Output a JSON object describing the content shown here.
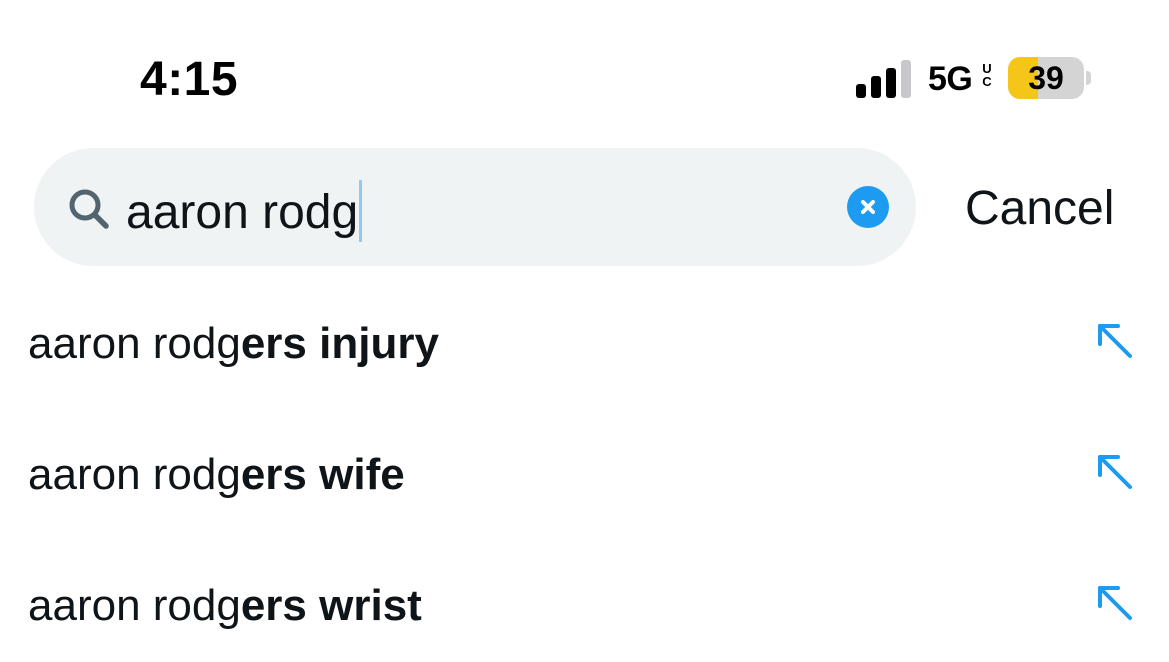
{
  "status_bar": {
    "time": "4:15",
    "network": "5G",
    "network_suffix_top": "U",
    "network_suffix_bottom": "C",
    "battery_level": "39",
    "battery_fraction": 0.39,
    "signal_bars_active": 3,
    "signal_bars_total": 4
  },
  "search": {
    "query": "aaron rodg",
    "search_icon": "search-icon",
    "clear_icon": "clear-x-icon",
    "cancel_label": "Cancel"
  },
  "suggestions": [
    {
      "typed": "aaron rodg",
      "completion": "ers injury",
      "icon": "fill-query-arrow-icon"
    },
    {
      "typed": "aaron rodg",
      "completion": "ers wife",
      "icon": "fill-query-arrow-icon"
    },
    {
      "typed": "aaron rodg",
      "completion": "ers wrist",
      "icon": "fill-query-arrow-icon"
    }
  ],
  "colors": {
    "accent": "#1d9bf0",
    "pill_background": "#eff3f4",
    "text": "#0f1419",
    "battery_fill": "#f5c518",
    "caret": "#8ecaf5"
  }
}
